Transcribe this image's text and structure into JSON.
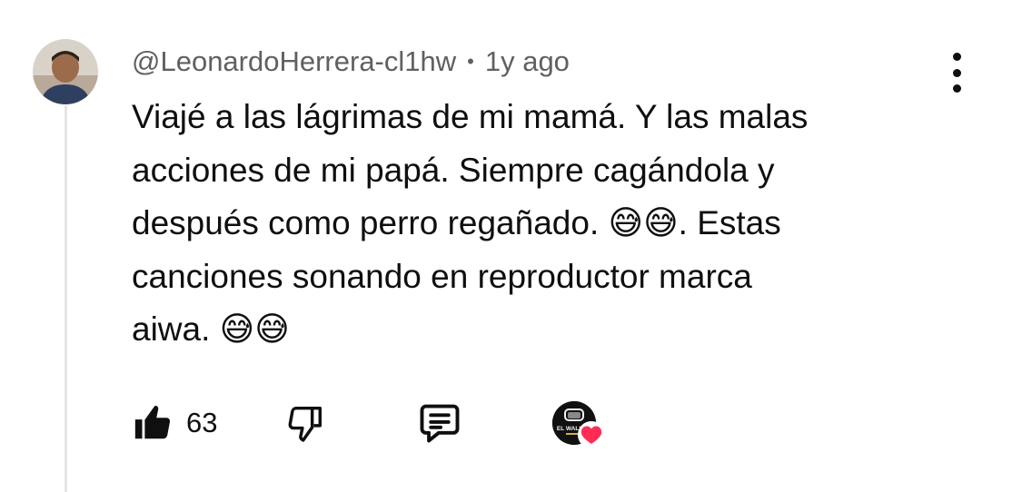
{
  "comment": {
    "author": "@LeonardoHerrera-cl1hw",
    "separator": "•",
    "time": "1y ago",
    "text": "Viajé a las lágrimas de mi mamá. Y las malas\nacciones de mi papá. Siempre cagándola y\ndespués como perro regañado. 😅😅. Estas\ncanciones sonando en reproductor marca\naiwa. 😅😅"
  },
  "actions": {
    "like_count": "63",
    "like_icon": "thumbs-up-icon",
    "dislike_icon": "thumbs-down-icon",
    "reply_icon": "comment-reply-icon",
    "creator_heart_icon": "heart-icon",
    "creator_badge_text": "EL WALKER"
  },
  "colors": {
    "text": "#0f0f0f",
    "meta": "#606060",
    "thread_line": "#e5e5e5",
    "heart": "#ff2d55"
  }
}
